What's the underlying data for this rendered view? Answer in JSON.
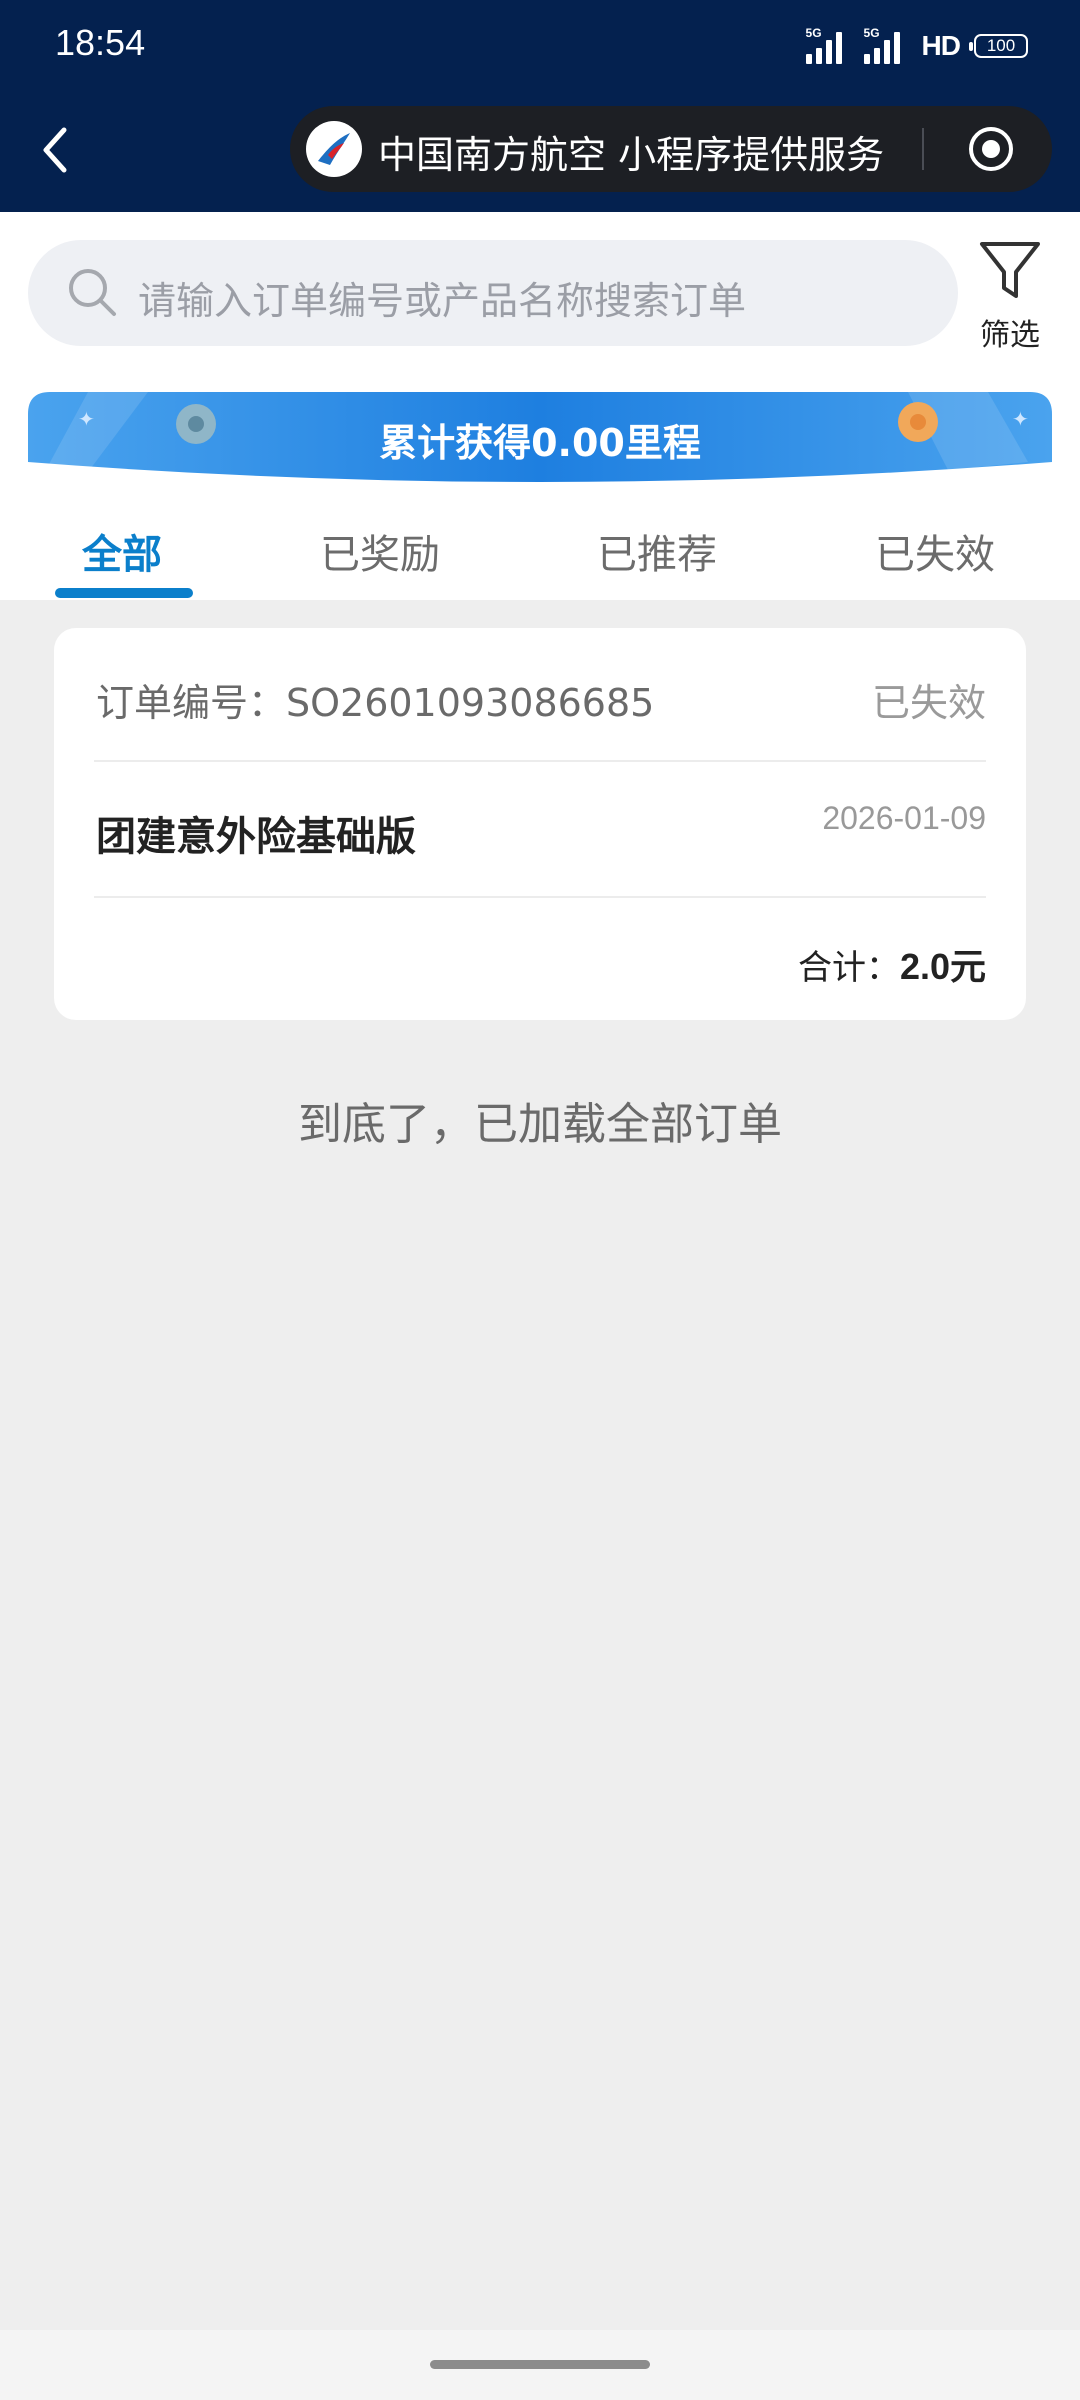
{
  "status_bar": {
    "time": "18:54",
    "signal1_label": "5G",
    "signal2_label": "5G",
    "hd_label": "HD",
    "battery": "100"
  },
  "mini_program": {
    "service_text": "中国南方航空 小程序提供服务"
  },
  "search": {
    "placeholder": "请输入订单编号或产品名称搜索订单",
    "filter_label": "筛选"
  },
  "banner": {
    "text": "累计获得0.00里程"
  },
  "tabs": [
    {
      "label": "全部",
      "active": true
    },
    {
      "label": "已奖励",
      "active": false
    },
    {
      "label": "已推荐",
      "active": false
    },
    {
      "label": "已失效",
      "active": false
    }
  ],
  "orders": [
    {
      "order_no_label": "订单编号：SO2601093086685",
      "status": "已失效",
      "product": "团建意外险基础版",
      "date": "2026-01-09",
      "total_label": "合计：",
      "total_value": "2.0元"
    }
  ],
  "end_message": "到底了，已加载全部订单",
  "colors": {
    "topbar": "#04214f",
    "accent": "#0b7fcb",
    "banner_blue": "#1e88e5",
    "page_bg": "#eeeeee"
  }
}
